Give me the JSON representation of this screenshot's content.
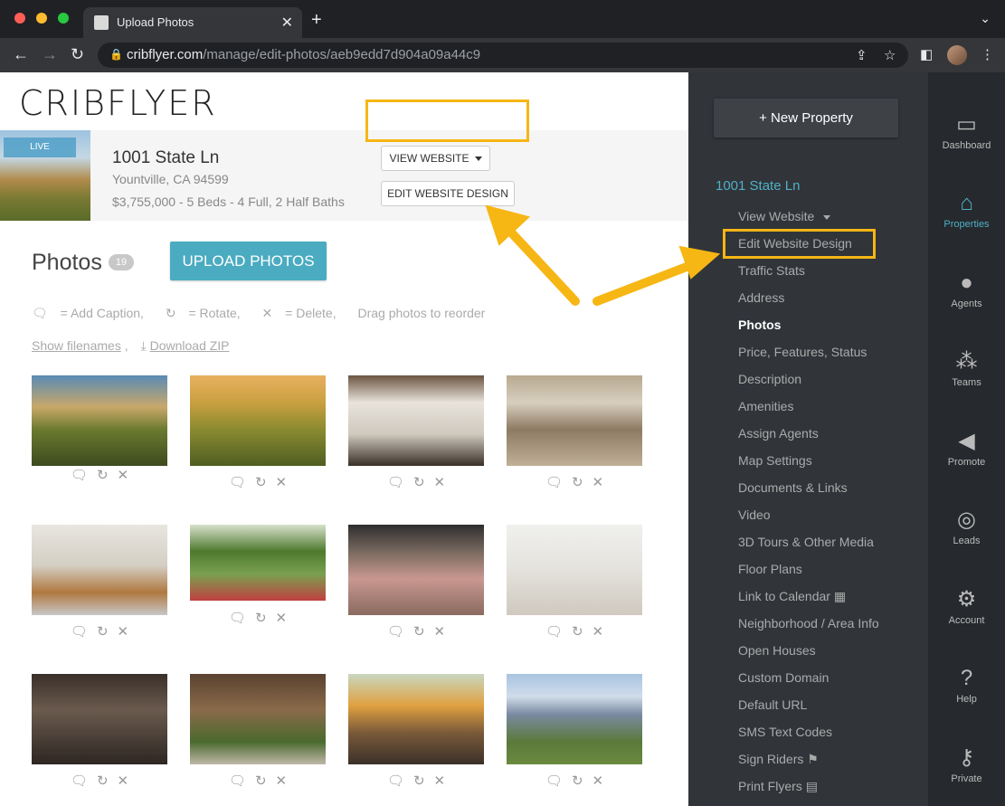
{
  "browser": {
    "tab_title": "Upload Photos",
    "url_host": "cribflyer.com",
    "url_path": "/manage/edit-photos/aeb9edd7d904a09a44c9"
  },
  "main": {
    "logo": "CRIBFLYER",
    "property": {
      "badge": "LIVE",
      "name": "1001 State Ln",
      "city": "Yountville, CA 94599",
      "info": "$3,755,000 - 5 Beds - 4 Full, 2 Half Baths",
      "view_website_label": "VIEW WEBSITE",
      "edit_design_label": "EDIT WEBSITE DESIGN"
    },
    "photos_title": "Photos",
    "photo_count": "19",
    "upload_label": "UPLOAD PHOTOS",
    "legend": {
      "caption": "= Add Caption,",
      "rotate": "= Rotate,",
      "delete": "= Delete,",
      "drag": "Drag photos to reorder"
    },
    "links": {
      "show_filenames": "Show filenames",
      "separator": ",",
      "download_zip": "Download ZIP"
    }
  },
  "sidebar": {
    "new_property_label": "New Property",
    "property_name": "1001 State Ln",
    "items": [
      "View Website",
      "Edit Website Design",
      "Traffic Stats",
      "Address",
      "Photos",
      "Price, Features, Status",
      "Description",
      "Amenities",
      "Assign Agents",
      "Map Settings",
      "Documents & Links",
      "Video",
      "3D Tours & Other Media",
      "Floor Plans",
      "Link to Calendar",
      "Neighborhood / Area Info",
      "Open Houses",
      "Custom Domain",
      "Default URL",
      "SMS Text Codes",
      "Sign Riders",
      "Print Flyers"
    ]
  },
  "rnav": {
    "items": [
      {
        "label": "Dashboard",
        "icon": "dashboard-icon"
      },
      {
        "label": "Properties",
        "icon": "home-icon"
      },
      {
        "label": "Agents",
        "icon": "user-icon"
      },
      {
        "label": "Teams",
        "icon": "team-icon"
      },
      {
        "label": "Promote",
        "icon": "megaphone-icon"
      },
      {
        "label": "Leads",
        "icon": "target-icon"
      },
      {
        "label": "Account",
        "icon": "gear-icon"
      },
      {
        "label": "Help",
        "icon": "question-icon"
      },
      {
        "label": "Private",
        "icon": "key-icon"
      }
    ]
  },
  "colors": {
    "accent": "#4aabc1",
    "highlight": "#f6b614",
    "sidebar_bg": "#31353a",
    "rnav_bg": "#26292d"
  }
}
